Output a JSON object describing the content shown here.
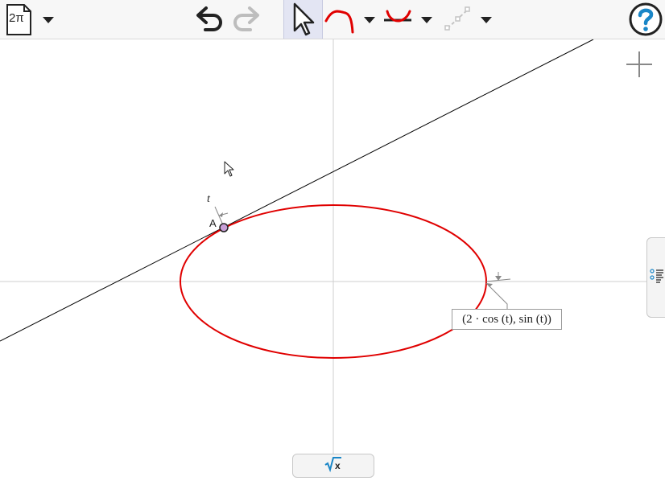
{
  "toolbar": {
    "document_label": "2π",
    "document_icon": "document-icon",
    "tools": [
      "undo-icon",
      "redo-icon",
      "pointer-icon",
      "curve-icon",
      "conic-icon",
      "segment-icon",
      "help-icon"
    ]
  },
  "graph": {
    "axes_visible": true,
    "point_label": "A",
    "parameter_label": "t",
    "expression": "(2 · cos (t), sin (t))",
    "curve_color": "#e00000",
    "tangent_color": "#000000"
  },
  "panels": {
    "add_icon": "plus-icon",
    "side_panel_icon": "list-icon",
    "math_panel_icon": "sqrt-x-icon"
  }
}
